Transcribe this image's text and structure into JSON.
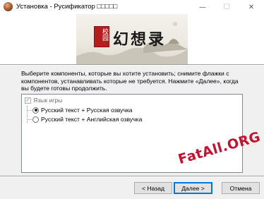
{
  "window": {
    "title": "Установка - Русификатор □□□□□",
    "icon": "setup-app-icon",
    "controls": {
      "minimize": "—",
      "maximize": "☐",
      "close": "✕"
    }
  },
  "banner": {
    "seal_text": "校园",
    "brush_text": "幻想录"
  },
  "description": "Выберите компоненты, которые вы хотите установить; снимите флажки с компонентов, устанавливать которые не требуется. Нажмите «Далее», когда вы будете готовы продолжить.",
  "components": {
    "group_label": "Язык игры",
    "group_checked": true,
    "options": [
      {
        "label": "Русский текст + Русская озвучка",
        "selected": true
      },
      {
        "label": "Русский текст + Английская озвучка",
        "selected": false
      }
    ]
  },
  "watermark": "FatAll.ORG",
  "buttons": {
    "back": "< Назад",
    "next": "Далее >",
    "cancel": "Отмена"
  },
  "colors": {
    "watermark": "#c8102e",
    "seal": "#b81d1d",
    "default_button_border": "#0078d7"
  }
}
